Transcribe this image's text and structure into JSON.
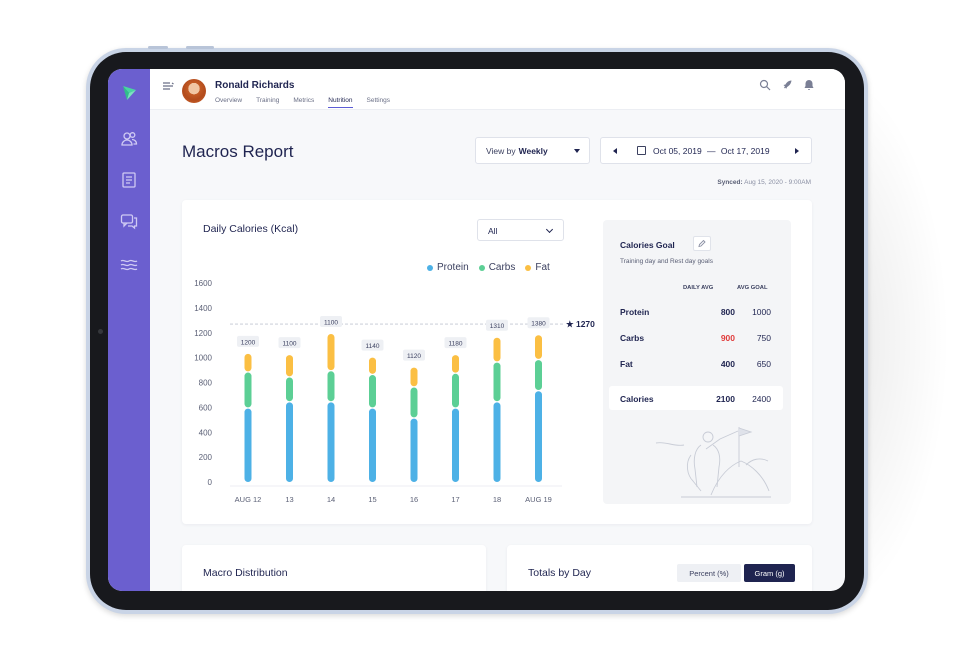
{
  "header": {
    "user_name": "Ronald Richards",
    "tabs": [
      "Overview",
      "Training",
      "Metrics",
      "Nutrition",
      "Settings"
    ],
    "active_tab": "Nutrition"
  },
  "page": {
    "title": "Macros Report",
    "view_by_prefix": "View by",
    "view_by_value": "Weekly",
    "date_start": "Oct 05, 2019",
    "date_sep": "—",
    "date_end": "Oct 17, 2019",
    "synced_label": "Synced:",
    "synced_value": "Aug 15, 2020 - 9:00AM"
  },
  "daily_calories": {
    "title": "Daily Calories (Kcal)",
    "filter_value": "All",
    "goal_marker": "★ 1270"
  },
  "chart_data": {
    "type": "bar",
    "stacked": true,
    "title": "Daily Calories (Kcal)",
    "categories": [
      "AUG 12",
      "13",
      "14",
      "15",
      "16",
      "17",
      "18",
      "AUG 19"
    ],
    "series": [
      {
        "name": "Protein",
        "color": "#4db1e6",
        "values": [
          590,
          640,
          640,
          590,
          510,
          590,
          640,
          730
        ]
      },
      {
        "name": "Carbs",
        "color": "#5ccf95",
        "values": [
          290,
          200,
          250,
          270,
          250,
          280,
          320,
          250
        ]
      },
      {
        "name": "Fat",
        "color": "#fbbf43",
        "values": [
          150,
          180,
          300,
          140,
          160,
          150,
          200,
          200
        ]
      }
    ],
    "data_labels": [
      "1200",
      "1100",
      "1100",
      "1140",
      "1120",
      "1180",
      "1310",
      "1380"
    ],
    "ylim": [
      0,
      1600
    ],
    "yticks": [
      0,
      200,
      400,
      600,
      800,
      1000,
      1200,
      1400,
      1600
    ],
    "goal_line": 1270,
    "legend_position": "top-right",
    "grid": false
  },
  "calories_goal": {
    "title": "Calories Goal",
    "subtitle": "Training day and Rest day goals",
    "col_daily": "DAILY AVG",
    "col_goal": "AVG GOAL",
    "rows": [
      {
        "label": "Protein",
        "daily": "800",
        "goal": "1000",
        "over": false
      },
      {
        "label": "Carbs",
        "daily": "900",
        "goal": "750",
        "over": true
      },
      {
        "label": "Fat",
        "daily": "400",
        "goal": "650",
        "over": false
      }
    ],
    "total": {
      "label": "Calories",
      "daily": "2100",
      "goal": "2400"
    }
  },
  "macro_distribution": {
    "title": "Macro Distribution"
  },
  "totals_by_day": {
    "title": "Totals by Day",
    "percent_label": "Percent (%)",
    "gram_label": "Gram (g)"
  },
  "icons": {
    "sidebar": [
      "logo-icon",
      "users-icon",
      "document-icon",
      "chat-icon",
      "waves-icon"
    ],
    "topbar": [
      "search-icon",
      "rocket-icon",
      "bell-icon"
    ]
  },
  "colors": {
    "sidebar": "#6b5fcf",
    "protein": "#4db1e6",
    "carbs": "#5ccf95",
    "fat": "#fbbf43",
    "over_goal": "#e03b3b",
    "primary_dark": "#1f2450"
  }
}
